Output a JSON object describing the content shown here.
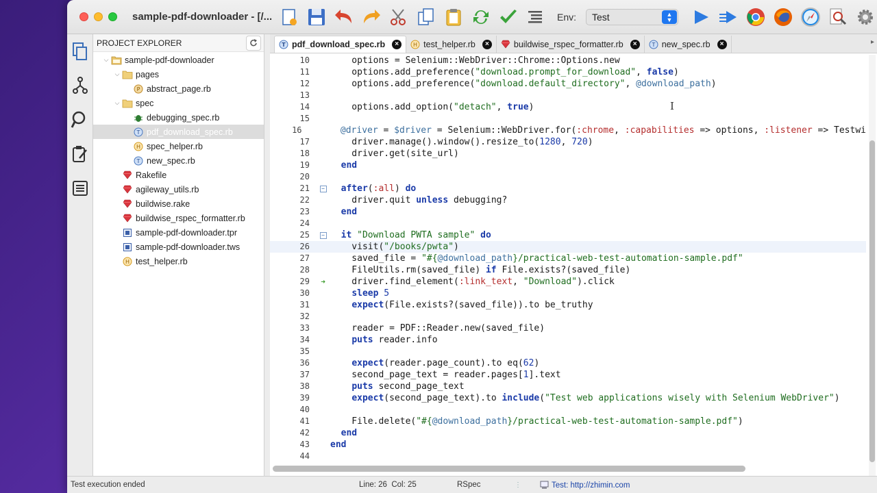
{
  "window": {
    "title": "sample-pdf-downloader - [/..."
  },
  "toolbar": {
    "buttons": [
      "new-file",
      "save",
      "undo",
      "redo",
      "cut",
      "copy",
      "paste",
      "refresh",
      "check",
      "format"
    ],
    "env_label": "Env:",
    "env_value": "Test"
  },
  "explorer": {
    "title": "PROJECT EXPLORER",
    "items": [
      {
        "label": "sample-pdf-downloader",
        "icon": "project-folder-icon",
        "chevron": "⌄"
      },
      {
        "label": "pages",
        "icon": "folder-icon",
        "chevron": "⌄"
      },
      {
        "label": "abstract_page.rb",
        "icon": "page-file-icon",
        "chevron": ""
      },
      {
        "label": "spec",
        "icon": "folder-icon",
        "chevron": "⌄"
      },
      {
        "label": "debugging_spec.rb",
        "icon": "bug-icon",
        "chevron": ""
      },
      {
        "label": "pdf_download_spec.rb",
        "icon": "test-file-icon",
        "chevron": ""
      },
      {
        "label": "spec_helper.rb",
        "icon": "helper-file-icon",
        "chevron": ""
      },
      {
        "label": "new_spec.rb",
        "icon": "test-file-icon",
        "chevron": ""
      },
      {
        "label": "Rakefile",
        "icon": "ruby-gem-icon",
        "chevron": ""
      },
      {
        "label": "agileway_utils.rb",
        "icon": "ruby-gem-icon",
        "chevron": ""
      },
      {
        "label": "buildwise.rake",
        "icon": "ruby-gem-icon",
        "chevron": ""
      },
      {
        "label": "buildwise_rspec_formatter.rb",
        "icon": "ruby-gem-icon",
        "chevron": ""
      },
      {
        "label": "sample-pdf-downloader.tpr",
        "icon": "project-file-icon",
        "chevron": ""
      },
      {
        "label": "sample-pdf-downloader.tws",
        "icon": "project-file-icon",
        "chevron": ""
      },
      {
        "label": "test_helper.rb",
        "icon": "helper-file-icon",
        "chevron": ""
      }
    ]
  },
  "tabs": [
    {
      "label": "pdf_download_spec.rb",
      "icon": "test-file-icon",
      "active": true
    },
    {
      "label": "test_helper.rb",
      "icon": "helper-file-icon",
      "active": false
    },
    {
      "label": "buildwise_rspec_formatter.rb",
      "icon": "ruby-gem-icon",
      "active": false
    },
    {
      "label": "new_spec.rb",
      "icon": "test-file-icon",
      "active": false
    }
  ],
  "code": {
    "lines": [
      {
        "n": "10",
        "html": "    options = Selenium::WebDriver::Chrome::Options.new"
      },
      {
        "n": "11",
        "html": "    options.add_preference(<span class='s'>\"download.prompt_for_download\"</span>, <span class='k'>false</span>)"
      },
      {
        "n": "12",
        "html": "    options.add_preference(<span class='s'>\"download.default_directory\"</span>, <span class='iv'>@download_path</span>)"
      },
      {
        "n": "13",
        "html": ""
      },
      {
        "n": "14",
        "html": "    options.add_option(<span class='s'>\"detach\"</span>, <span class='k'>true</span>)"
      },
      {
        "n": "15",
        "html": ""
      },
      {
        "n": "16",
        "html": "    <span class='iv'>@driver</span> = <span class='gv'>$driver</span> = Selenium::WebDriver.for(<span class='sy'>:chrome</span>, <span class='sy'>:capabilities</span> =&gt; options, <span class='sy'>:listener</span> =&gt; Testwi"
      },
      {
        "n": "17",
        "html": "    driver.manage().window().resize_to(<span class='n'>1280</span>, <span class='n'>720</span>)"
      },
      {
        "n": "18",
        "html": "    driver.get(site_url)"
      },
      {
        "n": "19",
        "html": "  <span class='k'>end</span>"
      },
      {
        "n": "20",
        "html": ""
      },
      {
        "n": "21",
        "html": "  <span class='k'>after</span>(<span class='sy'>:all</span>) <span class='k'>do</span>",
        "fold": true
      },
      {
        "n": "22",
        "html": "    driver.quit <span class='k'>unless</span> debugging?"
      },
      {
        "n": "23",
        "html": "  <span class='k'>end</span>"
      },
      {
        "n": "24",
        "html": ""
      },
      {
        "n": "25",
        "html": "  <span class='k'>it</span> <span class='s'>\"Download PWTA sample\"</span> <span class='k'>do</span>",
        "fold": true
      },
      {
        "n": "26",
        "html": "    visit(<span class='s'>\"/books/pwta\"</span>)",
        "hl": true
      },
      {
        "n": "27",
        "html": "    saved_file = <span class='s'>\"#{</span><span class='iv'>@download_path</span><span class='s'>}/practical-web-test-automation-sample.pdf\"</span>"
      },
      {
        "n": "28",
        "html": "    FileUtils.rm(saved_file) <span class='k'>if</span> File.exists?(saved_file)"
      },
      {
        "n": "29",
        "html": "    driver.find_element(<span class='sy'>:link_text</span>, <span class='s'>\"Download\"</span>).click",
        "run": true
      },
      {
        "n": "30",
        "html": "    <span class='k'>sleep</span> <span class='n'>5</span>"
      },
      {
        "n": "31",
        "html": "    <span class='k'>expect</span>(File.exists?(saved_file)).to be_truthy"
      },
      {
        "n": "32",
        "html": ""
      },
      {
        "n": "33",
        "html": "    reader = PDF::Reader.new(saved_file)"
      },
      {
        "n": "34",
        "html": "    <span class='k'>puts</span> reader.info"
      },
      {
        "n": "35",
        "html": ""
      },
      {
        "n": "36",
        "html": "    <span class='k'>expect</span>(reader.page_count).to eq(<span class='n'>62</span>)"
      },
      {
        "n": "37",
        "html": "    second_page_text = reader.pages[<span class='n'>1</span>].text"
      },
      {
        "n": "38",
        "html": "    <span class='k'>puts</span> second_page_text"
      },
      {
        "n": "39",
        "html": "    <span class='k'>expect</span>(second_page_text).to <span class='k'>include</span>(<span class='s'>\"Test web applications wisely with Selenium WebDriver\"</span>)"
      },
      {
        "n": "40",
        "html": ""
      },
      {
        "n": "41",
        "html": "    File.delete(<span class='s'>\"#{</span><span class='iv'>@download_path</span><span class='s'>}/practical-web-test-automation-sample.pdf\"</span>)"
      },
      {
        "n": "42",
        "html": "  <span class='k'>end</span>"
      },
      {
        "n": "43",
        "html": "<span class='k'>end</span>"
      },
      {
        "n": "44",
        "html": ""
      }
    ]
  },
  "status": {
    "message": "Test execution ended",
    "position": "Line: 26  Col: 25",
    "mode": "RSpec",
    "target": "Test: http://zhimin.com"
  }
}
